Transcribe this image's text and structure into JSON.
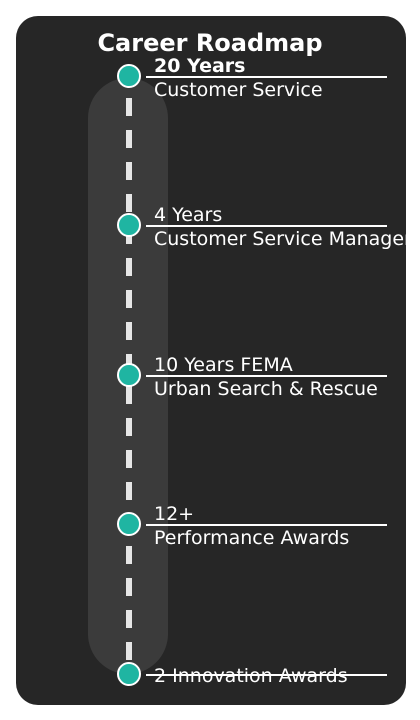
{
  "title": "Career Roadmap",
  "colors": {
    "card": "#262626",
    "track": "#3b3b3b",
    "node": "#1fb5a2",
    "line": "#ffffff",
    "spine": "#e6e6e6"
  },
  "milestones": [
    {
      "headline": "20 Years",
      "detail": "Customer Service",
      "emphasis": true
    },
    {
      "headline": "4 Years",
      "detail": "Customer Service Manager",
      "emphasis": false
    },
    {
      "headline": "10 Years FEMA",
      "detail": "Urban Search & Rescue",
      "emphasis": false
    },
    {
      "headline": "12+",
      "detail": "Performance Awards",
      "emphasis": false
    },
    {
      "headline": "2 Innovation Awards",
      "detail": "",
      "emphasis": false
    }
  ]
}
